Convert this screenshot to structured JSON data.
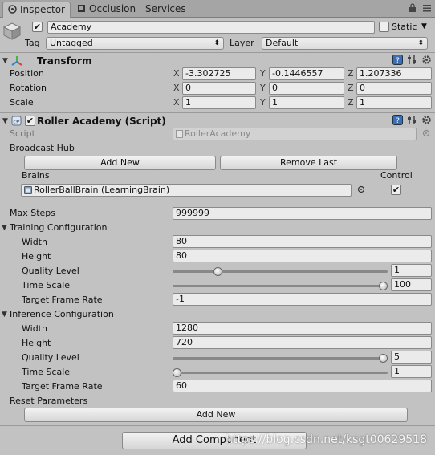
{
  "tabs": {
    "inspector": "Inspector",
    "occlusion": "Occlusion",
    "services": "Services"
  },
  "gameobject": {
    "name": "Academy",
    "static_label": "Static",
    "tag_label": "Tag",
    "tag_value": "Untagged",
    "layer_label": "Layer",
    "layer_value": "Default"
  },
  "transform": {
    "title": "Transform",
    "position_label": "Position",
    "rotation_label": "Rotation",
    "scale_label": "Scale",
    "position": {
      "x": "-3.302725",
      "y": "-0.1446557",
      "z": "1.207336"
    },
    "rotation": {
      "x": "0",
      "y": "0",
      "z": "0"
    },
    "scale": {
      "x": "1",
      "y": "1",
      "z": "1"
    },
    "axis_x": "X",
    "axis_y": "Y",
    "axis_z": "Z"
  },
  "script_component": {
    "title": "Roller Academy (Script)",
    "script_label": "Script",
    "script_value": "RollerAcademy",
    "broadcast_hub_label": "Broadcast Hub",
    "add_new_label": "Add New",
    "remove_last_label": "Remove Last",
    "brains_label": "Brains",
    "control_label": "Control",
    "brain_value": "RollerBallBrain (LearningBrain)",
    "control_checked": true,
    "max_steps_label": "Max Steps",
    "max_steps_value": "999999"
  },
  "training": {
    "title": "Training Configuration",
    "width_label": "Width",
    "width_value": "80",
    "height_label": "Height",
    "height_value": "80",
    "quality_label": "Quality Level",
    "quality_value": "1",
    "quality_fraction": 0.2,
    "timescale_label": "Time Scale",
    "timescale_value": "100",
    "timescale_fraction": 1.0,
    "framerate_label": "Target Frame Rate",
    "framerate_value": "-1"
  },
  "inference": {
    "title": "Inference Configuration",
    "width_label": "Width",
    "width_value": "1280",
    "height_label": "Height",
    "height_value": "720",
    "quality_label": "Quality Level",
    "quality_value": "5",
    "quality_fraction": 1.0,
    "timescale_label": "Time Scale",
    "timescale_value": "1",
    "timescale_fraction": 0.0,
    "framerate_label": "Target Frame Rate",
    "framerate_value": "60"
  },
  "reset": {
    "title": "Reset Parameters",
    "add_new_label": "Add New"
  },
  "add_component_label": "Add Component",
  "watermark": "https://blog.csdn.net/ksgt00629518",
  "colors": {
    "panel_bg": "#c2c2c2",
    "field_bg": "#ebebeb",
    "tab_bar": "#a5a5a5",
    "checkmark": "#111111"
  }
}
